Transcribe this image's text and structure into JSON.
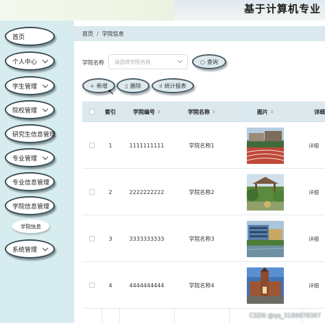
{
  "header": {
    "title": "基于计算机专业"
  },
  "sidebar": {
    "items": [
      {
        "label": "首页",
        "has_chevron": false
      },
      {
        "label": "个人中心",
        "has_chevron": true
      },
      {
        "label": "学生管理",
        "has_chevron": true
      },
      {
        "label": "院校管理",
        "has_chevron": true
      },
      {
        "label": "研究生信息管理",
        "has_chevron": false
      },
      {
        "label": "专业管理",
        "has_chevron": true
      },
      {
        "label": "专业信息管理",
        "has_chevron": false
      },
      {
        "label": "学院信息管理",
        "has_chevron": false
      },
      {
        "label": "系统管理",
        "has_chevron": true
      }
    ],
    "submenu": {
      "label": "学院信息"
    }
  },
  "breadcrumb": {
    "home": "首页",
    "separator": "/",
    "current": "学院信息"
  },
  "search": {
    "label": "学院名称",
    "placeholder": "请选择学院名称",
    "button_label": "查询"
  },
  "toolbar": {
    "add_label": "新增",
    "delete_label": "删除",
    "stats_label": "统计报表"
  },
  "table": {
    "columns": [
      "索引",
      "学院编号",
      "学院名称",
      "图片",
      "详细"
    ],
    "rows": [
      {
        "index": "1",
        "code": "1111111111",
        "name": "学院名称1",
        "image": "running-track",
        "detail": "详细"
      },
      {
        "index": "2",
        "code": "2222222222",
        "name": "学院名称2",
        "image": "garden-pavilion",
        "detail": "详细"
      },
      {
        "index": "3",
        "code": "3333333333",
        "name": "学院名称3",
        "image": "lake-building",
        "detail": "详细"
      },
      {
        "index": "4",
        "code": "4444444444",
        "name": "学院名称4",
        "image": "brick-tower",
        "detail": "详细"
      }
    ]
  },
  "watermark": "CSDN @qq_3166678367",
  "colors": {
    "sidebar_bg": "#d7ecef",
    "header_bar_bg": "#dbe9ee",
    "button_bg": "#dde9ec",
    "button_border": "#4a5a64"
  }
}
